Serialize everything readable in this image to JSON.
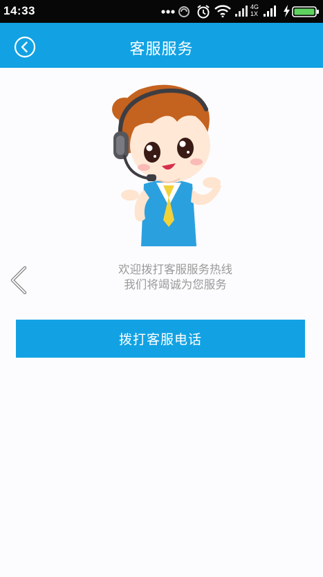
{
  "status_bar": {
    "time": "14:33",
    "network_label_top": "4G",
    "network_label_bottom": "1X",
    "icons": [
      "more-dots-icon",
      "sync-icon",
      "alarm-icon",
      "wifi-icon",
      "signal-4g-icon",
      "signal-icon",
      "charging-icon",
      "battery-icon"
    ],
    "battery_level": 1.0,
    "battery_color": "#5fd35f"
  },
  "header": {
    "title": "客服服务",
    "back_icon": "back-circle-icon",
    "color": "#12a2e3"
  },
  "mascot": {
    "icon": "customer-service-girl-illustration"
  },
  "welcome": {
    "line1": "欢迎拨打客服服务热线",
    "line2": "我们将竭诚为您服务"
  },
  "side_nav": {
    "icon": "chevron-left-icon"
  },
  "call_button": {
    "label": "拨打客服电话",
    "color": "#12a2e3"
  }
}
